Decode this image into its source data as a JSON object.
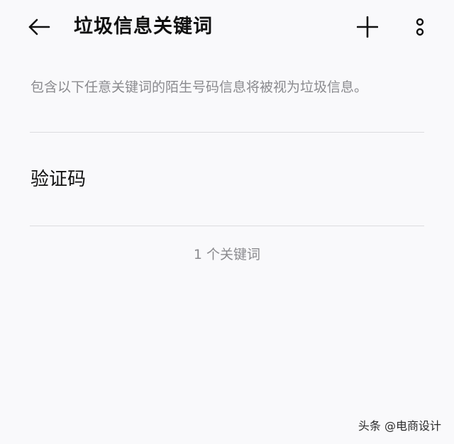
{
  "header": {
    "title": "垃圾信息关键词",
    "back_icon": "arrow-left-icon",
    "add_icon": "plus-icon",
    "more_icon": "more-vertical-icon"
  },
  "description": "包含以下任意关键词的陌生号码信息将被视为垃圾信息。",
  "keywords": [
    {
      "text": "验证码"
    }
  ],
  "count_label": "1 个关键词",
  "watermark": "头条 @电商设计",
  "colors": {
    "background": "#f9f9fb",
    "primary_text": "#111111",
    "secondary_text": "#8a8a8e",
    "divider": "#dcdcdf"
  }
}
